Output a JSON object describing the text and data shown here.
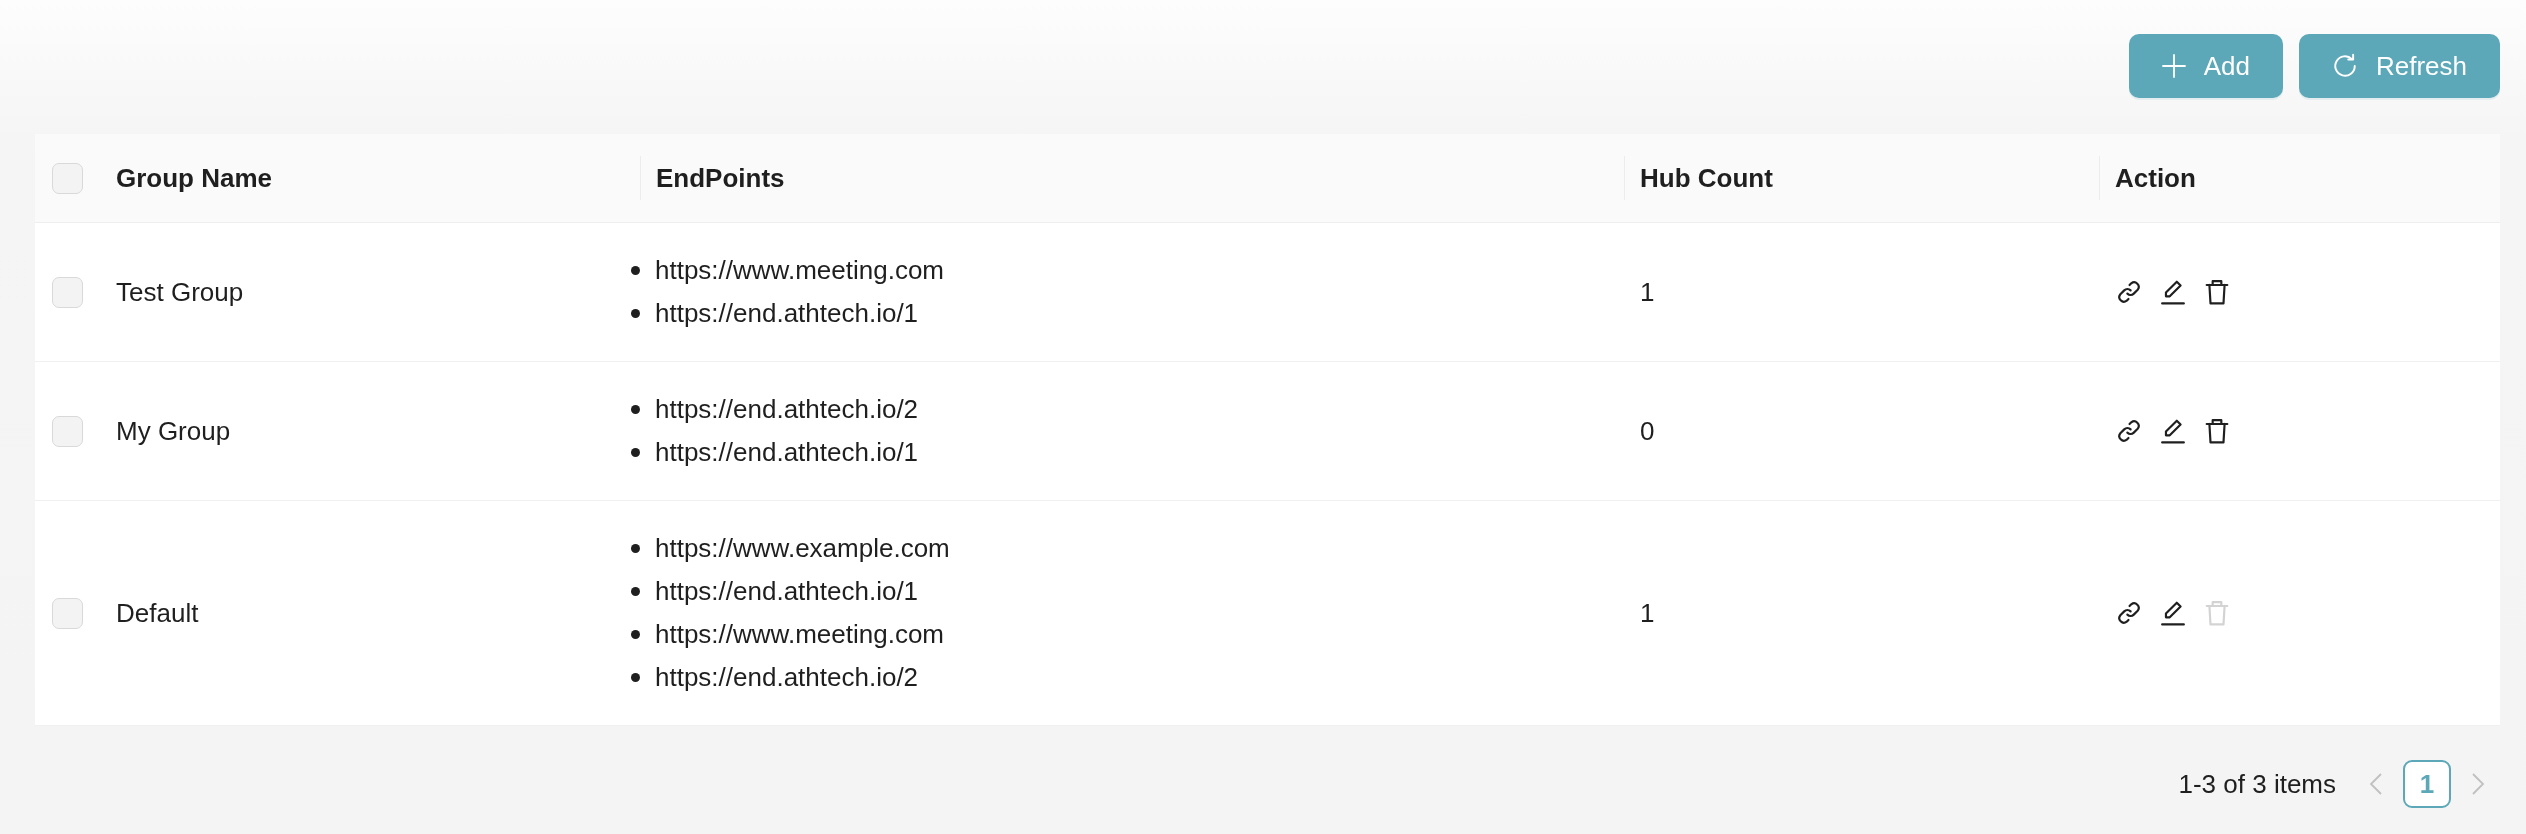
{
  "toolbar": {
    "buttons": [
      {
        "kind": "add",
        "label": "Add"
      },
      {
        "kind": "refresh",
        "label": "Refresh"
      }
    ]
  },
  "table": {
    "select_all": {
      "checked": false
    },
    "columns": [
      {
        "label": "Group Name"
      },
      {
        "label": "EndPoints"
      },
      {
        "label": "Hub Count"
      },
      {
        "label": "Action"
      }
    ],
    "rows": [
      {
        "checked": false,
        "group_name": "Test Group",
        "endpoints": [
          "https://www.meeting.com",
          "https://end.athtech.io/1"
        ],
        "hub_count": "1",
        "actions": [
          {
            "kind": "link",
            "disabled": false
          },
          {
            "kind": "edit",
            "disabled": false
          },
          {
            "kind": "delete",
            "disabled": false
          }
        ]
      },
      {
        "checked": false,
        "group_name": "My Group",
        "endpoints": [
          "https://end.athtech.io/2",
          "https://end.athtech.io/1"
        ],
        "hub_count": "0",
        "actions": [
          {
            "kind": "link",
            "disabled": false
          },
          {
            "kind": "edit",
            "disabled": false
          },
          {
            "kind": "delete",
            "disabled": false
          }
        ]
      },
      {
        "checked": false,
        "group_name": "Default",
        "endpoints": [
          "https://www.example.com",
          "https://end.athtech.io/1",
          "https://www.meeting.com",
          "https://end.athtech.io/2"
        ],
        "hub_count": "1",
        "actions": [
          {
            "kind": "link",
            "disabled": false
          },
          {
            "kind": "edit",
            "disabled": false
          },
          {
            "kind": "delete",
            "disabled": true
          }
        ]
      }
    ]
  },
  "pagination": {
    "summary": "1-3 of 3 items",
    "prev": {
      "disabled": true
    },
    "next": {
      "disabled": true
    },
    "pages": [
      {
        "label": "1",
        "selected": true
      }
    ]
  }
}
